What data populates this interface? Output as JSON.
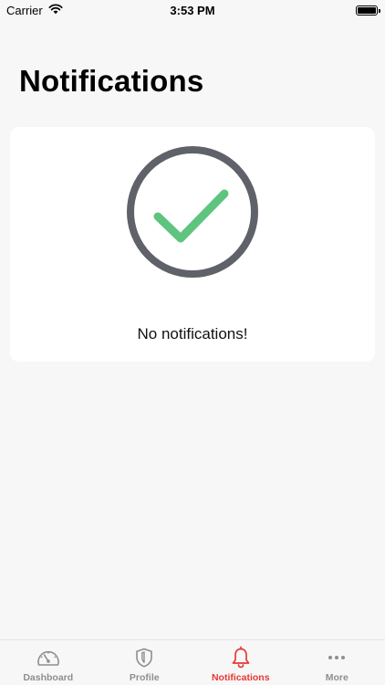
{
  "status_bar": {
    "carrier": "Carrier",
    "time": "3:53 PM",
    "battery_level": 1.0
  },
  "header": {
    "title": "Notifications"
  },
  "empty_state": {
    "icon": "checkmark-circle-icon",
    "message": "No notifications!",
    "colors": {
      "ring": "#5f6269",
      "check": "#5ec47f"
    }
  },
  "tab_bar": {
    "active_tab": "Notifications",
    "active_color": "#e53935",
    "inactive_color": "#8e8e93",
    "tabs": [
      {
        "label": "Dashboard",
        "icon": "speedometer-icon"
      },
      {
        "label": "Profile",
        "icon": "shield-icon"
      },
      {
        "label": "Notifications",
        "icon": "bell-icon"
      },
      {
        "label": "More",
        "icon": "ellipsis-icon"
      }
    ]
  }
}
